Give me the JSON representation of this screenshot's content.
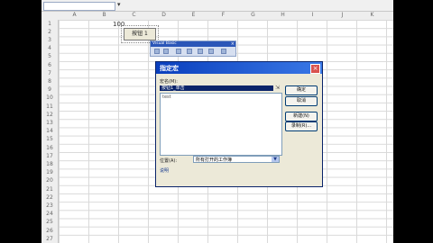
{
  "cell_value": "100",
  "form_button_label": "按钮 1",
  "toolbar": {
    "title": "Visual Basic",
    "close": "×"
  },
  "dialog": {
    "title": "指定宏",
    "close": "×",
    "macro_name_label": "宏名(M):",
    "macro_name_value": "按钮1_单击",
    "list_items": [
      "test"
    ],
    "buttons": {
      "ok": "确定",
      "cancel": "取消",
      "new": "新建(N)",
      "record": "录制(R)..."
    },
    "location_label": "位置(A):",
    "location_value": "所有打开的工作簿",
    "description_label": "说明"
  },
  "column_headers": [
    "A",
    "B",
    "C",
    "D",
    "E",
    "F",
    "G",
    "H",
    "I",
    "J",
    "K"
  ],
  "row_headers": [
    "1",
    "2",
    "3",
    "4",
    "5",
    "6",
    "7",
    "8",
    "9",
    "10",
    "11",
    "12",
    "13",
    "14",
    "15",
    "16",
    "17",
    "18",
    "19",
    "20",
    "21",
    "22",
    "23",
    "24",
    "25",
    "26",
    "27"
  ]
}
